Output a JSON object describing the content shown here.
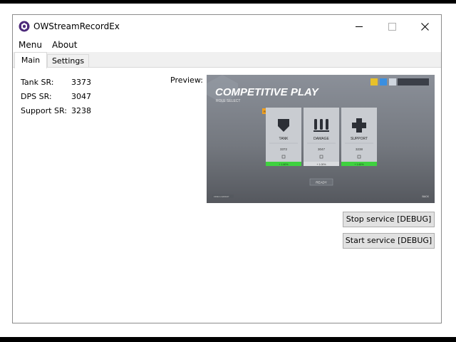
{
  "window": {
    "title": "OWStreamRecordEx"
  },
  "menu": {
    "items": [
      "Menu",
      "About"
    ]
  },
  "tabs": [
    {
      "label": "Main",
      "selected": true
    },
    {
      "label": "Settings",
      "selected": false
    }
  ],
  "stats": [
    {
      "label": "Tank SR:",
      "value": "3373"
    },
    {
      "label": "DPS SR:",
      "value": "3047"
    },
    {
      "label": "Support SR:",
      "value": "3238"
    }
  ],
  "preview": {
    "label": "Preview:",
    "heading": "COMPETITIVE PLAY",
    "subheading": "ROLE SELECT",
    "badge": "RANK LEADERS",
    "roles": [
      {
        "name": "TANK",
        "sr": "3372",
        "status": "+ 1.60%"
      },
      {
        "name": "DAMAGE",
        "sr": "3047",
        "status": "+ 1.00%"
      },
      {
        "name": "SUPPORT",
        "sr": "3238",
        "status": "+ 1.60%"
      }
    ],
    "ready": "READY",
    "footer_left": "FIND A GROUP",
    "footer_right": "BACK"
  },
  "buttons": {
    "stop": "Stop service [DEBUG]",
    "start": "Start service [DEBUG]"
  },
  "colors": {
    "accent": "#4d2a7a",
    "role_ok": "#3fd13f",
    "badge": "#f0a020"
  }
}
